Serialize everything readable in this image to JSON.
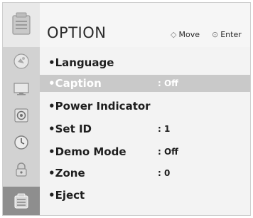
{
  "header": {
    "title": "OPTION",
    "hints": [
      {
        "icon": "dpad-icon",
        "glyph": "◇",
        "label": "Move"
      },
      {
        "icon": "ok-icon",
        "glyph": "⊙",
        "label": "Enter"
      }
    ]
  },
  "sidebar": {
    "items": [
      {
        "icon": "picture-icon"
      },
      {
        "icon": "screen-icon"
      },
      {
        "icon": "audio-icon"
      },
      {
        "icon": "time-icon"
      },
      {
        "icon": "lock-icon"
      },
      {
        "icon": "option-icon",
        "active": true
      }
    ]
  },
  "menu": {
    "items": [
      {
        "label": "•Language",
        "value": ""
      },
      {
        "label": "•Caption",
        "value": ": Off",
        "selected": true
      },
      {
        "label": "•Power Indicator",
        "value": ""
      },
      {
        "label": "•Set ID",
        "value": ": 1"
      },
      {
        "label": "•Demo Mode",
        "value": ": Off"
      },
      {
        "label": "•Zone",
        "value": ": 0"
      },
      {
        "label": "•Eject",
        "value": ""
      }
    ]
  }
}
